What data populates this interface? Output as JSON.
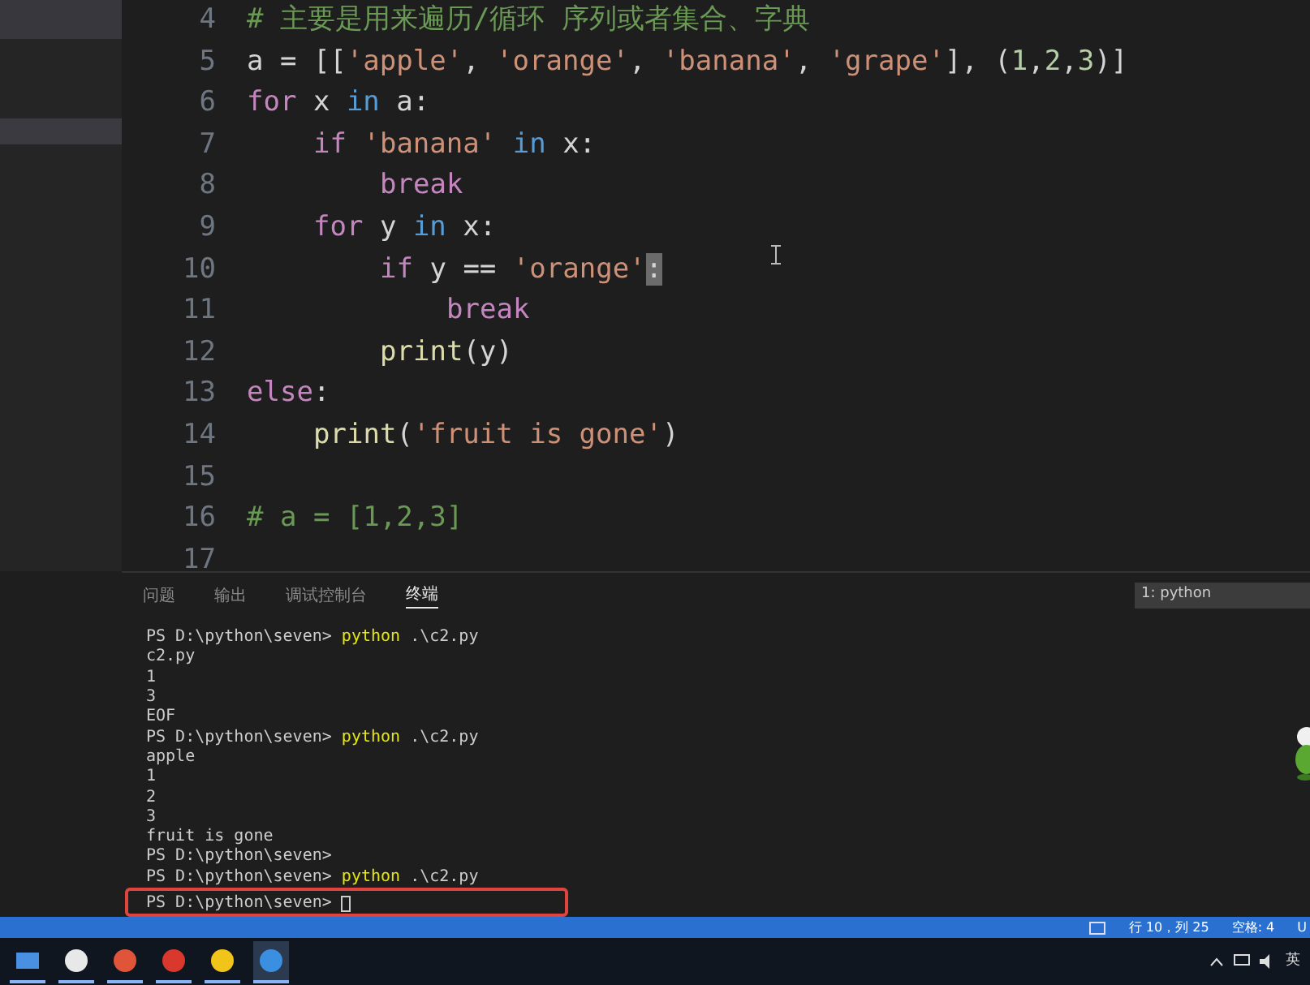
{
  "editor": {
    "lines": [
      {
        "number": "4",
        "tokens": [
          {
            "text": "# 主要是用来遍历/循环 序列或者集合、字典",
            "kind": "comment"
          }
        ]
      },
      {
        "number": "5",
        "tokens": [
          {
            "text": "a = [[",
            "kind": "plain"
          },
          {
            "text": "'apple'",
            "kind": "string"
          },
          {
            "text": ", ",
            "kind": "plain"
          },
          {
            "text": "'orange'",
            "kind": "string"
          },
          {
            "text": ", ",
            "kind": "plain"
          },
          {
            "text": "'banana'",
            "kind": "string"
          },
          {
            "text": ", ",
            "kind": "plain"
          },
          {
            "text": "'grape'",
            "kind": "string"
          },
          {
            "text": "], (",
            "kind": "plain"
          },
          {
            "text": "1",
            "kind": "number"
          },
          {
            "text": ",",
            "kind": "plain"
          },
          {
            "text": "2",
            "kind": "number"
          },
          {
            "text": ",",
            "kind": "plain"
          },
          {
            "text": "3",
            "kind": "number"
          },
          {
            "text": ")]",
            "kind": "plain"
          }
        ]
      },
      {
        "number": "6",
        "tokens": [
          {
            "text": "for",
            "kind": "control"
          },
          {
            "text": " x ",
            "kind": "plain"
          },
          {
            "text": "in",
            "kind": "keyword"
          },
          {
            "text": " a:",
            "kind": "plain"
          }
        ],
        "children": [
          {
            "number": "7",
            "tokens": [
              {
                "text": "if",
                "kind": "control"
              },
              {
                "text": " 'banana'",
                "kind": "string"
              },
              {
                "text": " in",
                "kind": "keyword"
              },
              {
                "text": " x:",
                "kind": "plain"
              }
            ],
            "children": [
              {
                "number": "8",
                "tokens": [
                  {
                    "text": "break",
                    "kind": "control"
                  }
                ]
              }
            ]
          },
          {
            "number": "9",
            "tokens": [
              {
                "text": "for",
                "kind": "control"
              },
              {
                "text": " y ",
                "kind": "plain"
              },
              {
                "text": "in",
                "kind": "keyword"
              },
              {
                "text": " x:",
                "kind": "plain"
              }
            ],
            "children": [
              {
                "number": "10",
                "tokens": [
                  {
                    "text": "if",
                    "kind": "control"
                  },
                  {
                    "text": " y == ",
                    "kind": "plain"
                  },
                  {
                    "text": "'orange'",
                    "kind": "string"
                  },
                  {
                    "text": ":",
                    "kind": "cursor"
                  }
                ],
                "children": [
                  {
                    "number": "11",
                    "tokens": [
                      {
                        "text": "break",
                        "kind": "control"
                      }
                    ]
                  }
                ]
              },
              {
                "number": "12",
                "tokens": [
                  {
                    "text": "print",
                    "kind": "function"
                  },
                  {
                    "text": "(y)",
                    "kind": "plain"
                  }
                ]
              }
            ]
          }
        ]
      },
      {
        "number": "13",
        "tokens": [
          {
            "text": "else",
            "kind": "control"
          },
          {
            "text": ":",
            "kind": "plain"
          }
        ],
        "children": [
          {
            "number": "14",
            "tokens": [
              {
                "text": "print",
                "kind": "function"
              },
              {
                "text": "(",
                "kind": "plain"
              },
              {
                "text": "'fruit is gone'",
                "kind": "string"
              },
              {
                "text": ")",
                "kind": "plain"
              }
            ]
          }
        ]
      },
      {
        "number": "15"
      },
      {
        "number": "16",
        "tokens": [
          {
            "text": "# a = [1,2,3]",
            "kind": "comment"
          }
        ]
      },
      {
        "number": "17"
      }
    ]
  },
  "panel": {
    "tabs": [
      {
        "label": "问题",
        "selected": false
      },
      {
        "label": "输出",
        "selected": false
      },
      {
        "label": "调试控制台",
        "selected": false
      },
      {
        "label": "终端",
        "selected": true
      }
    ],
    "terminal_selector": "1: python",
    "terminal_lines": [
      {
        "tokens": [
          {
            "text": "PS D:\\python\\seven> ",
            "kind": "plain"
          },
          {
            "text": "python",
            "kind": "command"
          },
          {
            "text": " .\\c2.py",
            "kind": "plain"
          }
        ]
      },
      {
        "tokens": [
          {
            "text": "c2.py",
            "kind": "plain"
          }
        ]
      },
      {
        "tokens": [
          {
            "text": "1",
            "kind": "plain"
          }
        ]
      },
      {
        "tokens": [
          {
            "text": "3",
            "kind": "plain"
          }
        ]
      },
      {
        "tokens": [
          {
            "text": "EOF",
            "kind": "plain"
          }
        ]
      },
      {
        "tokens": [
          {
            "text": "PS D:\\python\\seven> ",
            "kind": "plain"
          },
          {
            "text": "python",
            "kind": "command"
          },
          {
            "text": " .\\c2.py",
            "kind": "plain"
          }
        ]
      },
      {
        "tokens": [
          {
            "text": "apple",
            "kind": "plain"
          }
        ]
      },
      {
        "tokens": [
          {
            "text": "1",
            "kind": "plain"
          }
        ]
      },
      {
        "tokens": [
          {
            "text": "2",
            "kind": "plain"
          }
        ]
      },
      {
        "tokens": [
          {
            "text": "3",
            "kind": "plain"
          }
        ]
      },
      {
        "tokens": [
          {
            "text": "fruit is gone",
            "kind": "plain"
          }
        ]
      },
      {
        "tokens": [
          {
            "text": "PS D:\\python\\seven>",
            "kind": "plain"
          }
        ]
      },
      {
        "tokens": [
          {
            "text": "PS D:\\python\\seven> ",
            "kind": "plain"
          },
          {
            "text": "python",
            "kind": "command"
          },
          {
            "text": " .\\c2.py",
            "kind": "plain"
          }
        ]
      },
      {
        "tokens": [
          {
            "text": "PS D:\\python\\seven> ",
            "kind": "plain"
          }
        ],
        "cursor": true
      }
    ]
  },
  "status_bar": {
    "items": [
      "行 10，列 25",
      "空格: 4",
      "U"
    ]
  },
  "taskbar": {
    "apps": [
      {
        "selected": false
      },
      {
        "selected": false
      },
      {
        "selected": false
      },
      {
        "selected": false
      },
      {
        "selected": false
      },
      {
        "selected": true
      }
    ],
    "ime": "英"
  }
}
